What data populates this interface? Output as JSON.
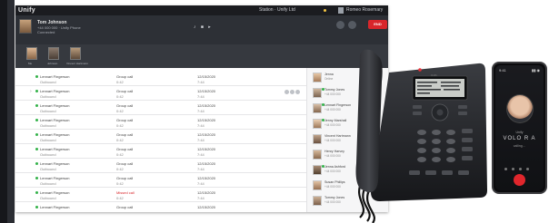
{
  "app": {
    "brand": "Unify",
    "topbar_mid": "Station · Unify Ltd",
    "user_name": "Romeo Rosemary",
    "call": {
      "name": "Tom Johnson",
      "subtitle": "+44 000 000 · Unify Phone",
      "status": "Connected",
      "controls": "♪ ■ ▸",
      "hangup": "END"
    },
    "participants": [
      {
        "label": "Me"
      },
      {
        "label": "Johnson"
      },
      {
        "label": "Vincent Hartmann"
      }
    ]
  },
  "history": [
    {
      "name": "Lennart Fingerson",
      "sub": "Outbound",
      "c2": "Group call",
      "c2b": "0:42",
      "c3": "12/15/2020",
      "c3b": "7:44"
    },
    {
      "name": "Lennart Fingerson",
      "sub": "Outbound",
      "c2": "Group call",
      "c2b": "0:42",
      "c3": "12/15/2020",
      "c3b": "7:44",
      "actions": true
    },
    {
      "name": "Lennart Fingerson",
      "sub": "Outbound",
      "c2": "Group call",
      "c2b": "0:42",
      "c3": "12/15/2020",
      "c3b": "7:44"
    },
    {
      "name": "Lennart Fingerson",
      "sub": "Outbound",
      "c2": "Group call",
      "c2b": "0:42",
      "c3": "12/15/2020",
      "c3b": "7:44"
    },
    {
      "name": "Lennart Fingerson",
      "sub": "Outbound",
      "c2": "Group call",
      "c2b": "0:42",
      "c3": "12/15/2020",
      "c3b": "7:44"
    },
    {
      "name": "Lennart Fingerson",
      "sub": "Outbound",
      "c2": "Group call",
      "c2b": "0:42",
      "c3": "12/15/2020",
      "c3b": "7:44"
    },
    {
      "name": "Lennart Fingerson",
      "sub": "Outbound",
      "c2": "Group call",
      "c2b": "0:42",
      "c3": "12/15/2020",
      "c3b": "7:44"
    },
    {
      "name": "Lennart Fingerson",
      "sub": "Outbound",
      "c2": "Group call",
      "c2b": "0:42",
      "c3": "12/15/2020",
      "c3b": "7:44"
    },
    {
      "name": "Lennart Fingerson",
      "sub": "Outbound",
      "c2": "Missed call",
      "c2b": "0:42",
      "c3": "12/15/2020",
      "c3b": "7:44",
      "missed": true
    },
    {
      "name": "Lennart Fingerson",
      "sub": "Outbound",
      "c2": "Group call",
      "c2b": "0:42",
      "c3": "12/15/2020",
      "c3b": "7:44"
    }
  ],
  "contacts": [
    {
      "name": "Jenna",
      "sub": "Online"
    },
    {
      "name": "Tommy Jones",
      "sub": "+44 000 000"
    },
    {
      "name": "Lennart Fingerson",
      "sub": "+44 000 000"
    },
    {
      "name": "Jenny Marshall",
      "sub": "+44 000 000"
    },
    {
      "name": "Vincent Hartmann",
      "sub": "+44 000 000"
    },
    {
      "name": "Henry Harvey",
      "sub": "+44 000 000"
    },
    {
      "name": "Jenna Ashford",
      "sub": "+44 000 000"
    },
    {
      "name": "Susan Phillips",
      "sub": "+44 000 000"
    },
    {
      "name": "Tommy Jones",
      "sub": "+44 000 000"
    }
  ],
  "desk_phone": {
    "brand": "Unify"
  },
  "mobile": {
    "time": "9:41",
    "status": "▮▮ ◉",
    "caller_label": "Unify",
    "caller_name": "VOLO R A",
    "caller_sub": "calling…"
  }
}
